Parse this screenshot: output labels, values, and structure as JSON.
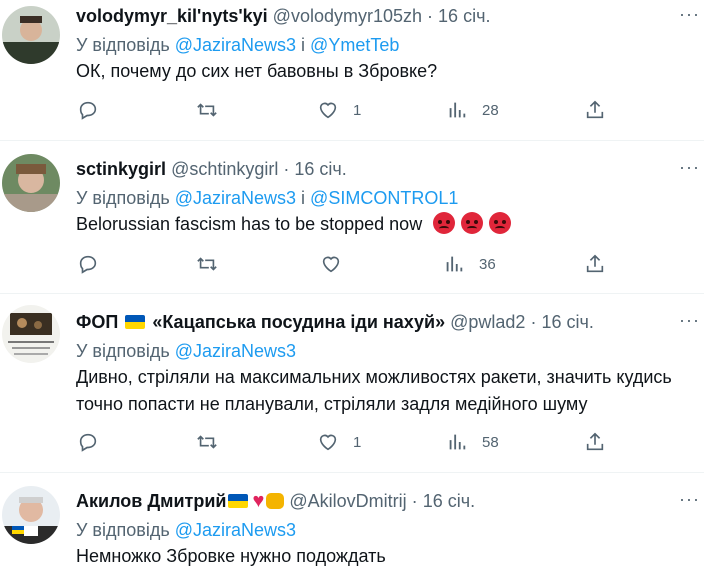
{
  "tweets": [
    {
      "name": "volodymyr_kil'nyts'kyi",
      "handle": "@volodymyr105zh",
      "dot": "·",
      "time": "16 січ.",
      "reply_prefix": "У відповідь",
      "reply_to_1": "@JaziraNews3",
      "reply_sep": " і ",
      "reply_to_2": "@YmetTeb",
      "text": "ОК, почему до сих нет бавовны в Збровке?",
      "likes": "1",
      "views": "28"
    },
    {
      "name": "sctinkygirl",
      "handle": "@schtinkygirl",
      "dot": "·",
      "time": "16 січ.",
      "reply_prefix": "У відповідь",
      "reply_to_1": "@JaziraNews3",
      "reply_sep": " і ",
      "reply_to_2": "@SIMCONTROL1",
      "text": "Belorussian fascism has to be stopped now",
      "likes": "",
      "views": "36"
    },
    {
      "name_prefix": "ФОП",
      "name": "«Кацапська посудина іди нахуй»",
      "handle": "@pwlad2",
      "dot": "·",
      "time": "16 січ.",
      "reply_prefix": "У відповідь",
      "reply_to_1": "@JaziraNews3",
      "text": "Дивно, стріляли на максимальних можливостях ракети, значить кудись точно попасти не планували, стріляли задля медійного шуму",
      "likes": "1",
      "views": "58"
    },
    {
      "name": "Акилов Дмитрий",
      "handle": "@AkilovDmitrij",
      "dot": "·",
      "time": "16 січ.",
      "reply_prefix": "У відповідь",
      "reply_to_1": "@JaziraNews3",
      "text": "Немножко Збровке нужно подождать"
    }
  ],
  "icons": {
    "more": "more-dots-icon",
    "reply": "reply-icon",
    "retweet": "retweet-icon",
    "like": "heart-icon",
    "views": "analytics-icon",
    "share": "share-icon",
    "flag": "ukraine-flag-icon",
    "angry": "angry-face-icon"
  },
  "colors": {
    "link": "#1d9bf0",
    "muted": "#536471",
    "text": "#0f1419",
    "flag_blue": "#0057b7",
    "flag_yellow": "#ffd700"
  },
  "more_label": "···"
}
